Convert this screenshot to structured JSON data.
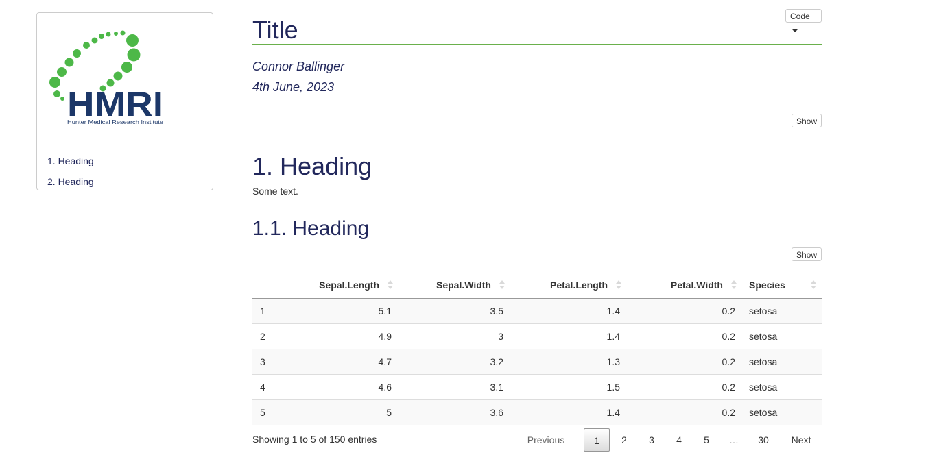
{
  "toc": {
    "logo_text": "HMRI",
    "logo_subtext": "Hunter Medical Research Institute",
    "items": [
      {
        "label": "1. Heading"
      },
      {
        "label": "2. Heading"
      }
    ]
  },
  "header": {
    "code_button": "Code",
    "title": "Title",
    "author": "Connor Ballinger",
    "date": "4th June, 2023"
  },
  "buttons": {
    "show_1": "Show",
    "show_2": "Show"
  },
  "content": {
    "h1": "1. Heading",
    "paragraph": "Some text.",
    "h2": "1.1. Heading"
  },
  "table": {
    "columns": [
      "",
      "Sepal.Length",
      "Sepal.Width",
      "Petal.Length",
      "Petal.Width",
      "Species"
    ],
    "rows": [
      [
        "1",
        "5.1",
        "3.5",
        "1.4",
        "0.2",
        "setosa"
      ],
      [
        "2",
        "4.9",
        "3",
        "1.4",
        "0.2",
        "setosa"
      ],
      [
        "3",
        "4.7",
        "3.2",
        "1.3",
        "0.2",
        "setosa"
      ],
      [
        "4",
        "4.6",
        "3.1",
        "1.5",
        "0.2",
        "setosa"
      ],
      [
        "5",
        "5",
        "3.6",
        "1.4",
        "0.2",
        "setosa"
      ]
    ],
    "info": "Showing 1 to 5 of 150 entries"
  },
  "pagination": {
    "previous": "Previous",
    "pages": [
      "1",
      "2",
      "3",
      "4",
      "5"
    ],
    "ellipsis": "…",
    "last": "30",
    "next": "Next",
    "current": "1"
  },
  "colors": {
    "heading": "#22285c",
    "accent_green": "#6ab04c",
    "logo_green": "#4db848",
    "logo_navy": "#1c3768"
  }
}
